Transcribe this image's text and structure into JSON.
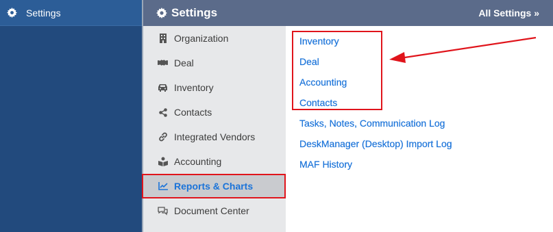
{
  "app_sidebar": {
    "settings_label": "Settings"
  },
  "header": {
    "title": "Settings",
    "all_settings_link": "All Settings »"
  },
  "settings_nav": {
    "items": [
      {
        "label": "Organization",
        "icon": "building-icon"
      },
      {
        "label": "Deal",
        "icon": "handshake-icon"
      },
      {
        "label": "Inventory",
        "icon": "car-icon"
      },
      {
        "label": "Contacts",
        "icon": "share-icon"
      },
      {
        "label": "Integrated Vendors",
        "icon": "link-icon"
      },
      {
        "label": "Accounting",
        "icon": "book-reader-icon"
      },
      {
        "label": "Reports & Charts",
        "icon": "line-chart-icon",
        "active": true
      },
      {
        "label": "Document Center",
        "icon": "comments-icon"
      }
    ]
  },
  "reports": {
    "links": [
      "Inventory",
      "Deal",
      "Accounting",
      "Contacts",
      "Tasks, Notes, Communication Log",
      "DeskManager (Desktop) Import Log",
      "MAF History"
    ]
  },
  "colors": {
    "sidebar": "#224a7d",
    "header": "#5b6b8a",
    "link": "#1a73d9",
    "highlight": "#e0141b"
  }
}
